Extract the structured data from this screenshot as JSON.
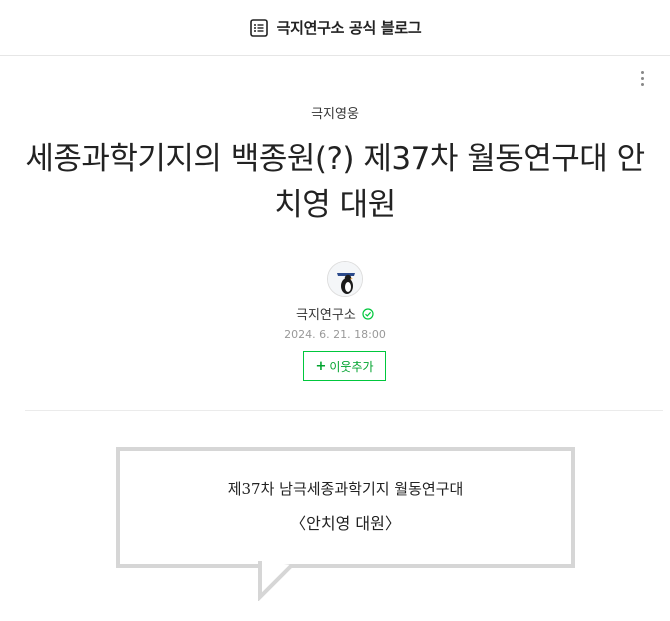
{
  "header": {
    "blog_title": "극지연구소 공식 블로그",
    "icon": "list-icon"
  },
  "post": {
    "category": "극지영웅",
    "title": "세종과학기지의 백종원(?) 제37차 월동연구대 안치영 대원",
    "author": "극지연구소",
    "date": "2024. 6. 21. 18:00",
    "follow_label": "이웃추가",
    "more_icon": "more-vertical-icon"
  },
  "quote": {
    "line1": "제37차 남극세종과학기지 월동연구대",
    "line2": "〈안치영 대원〉"
  },
  "colors": {
    "accent_green": "#00c73c",
    "divider": "#ebebeb",
    "quote_border": "#d6d6d6"
  }
}
